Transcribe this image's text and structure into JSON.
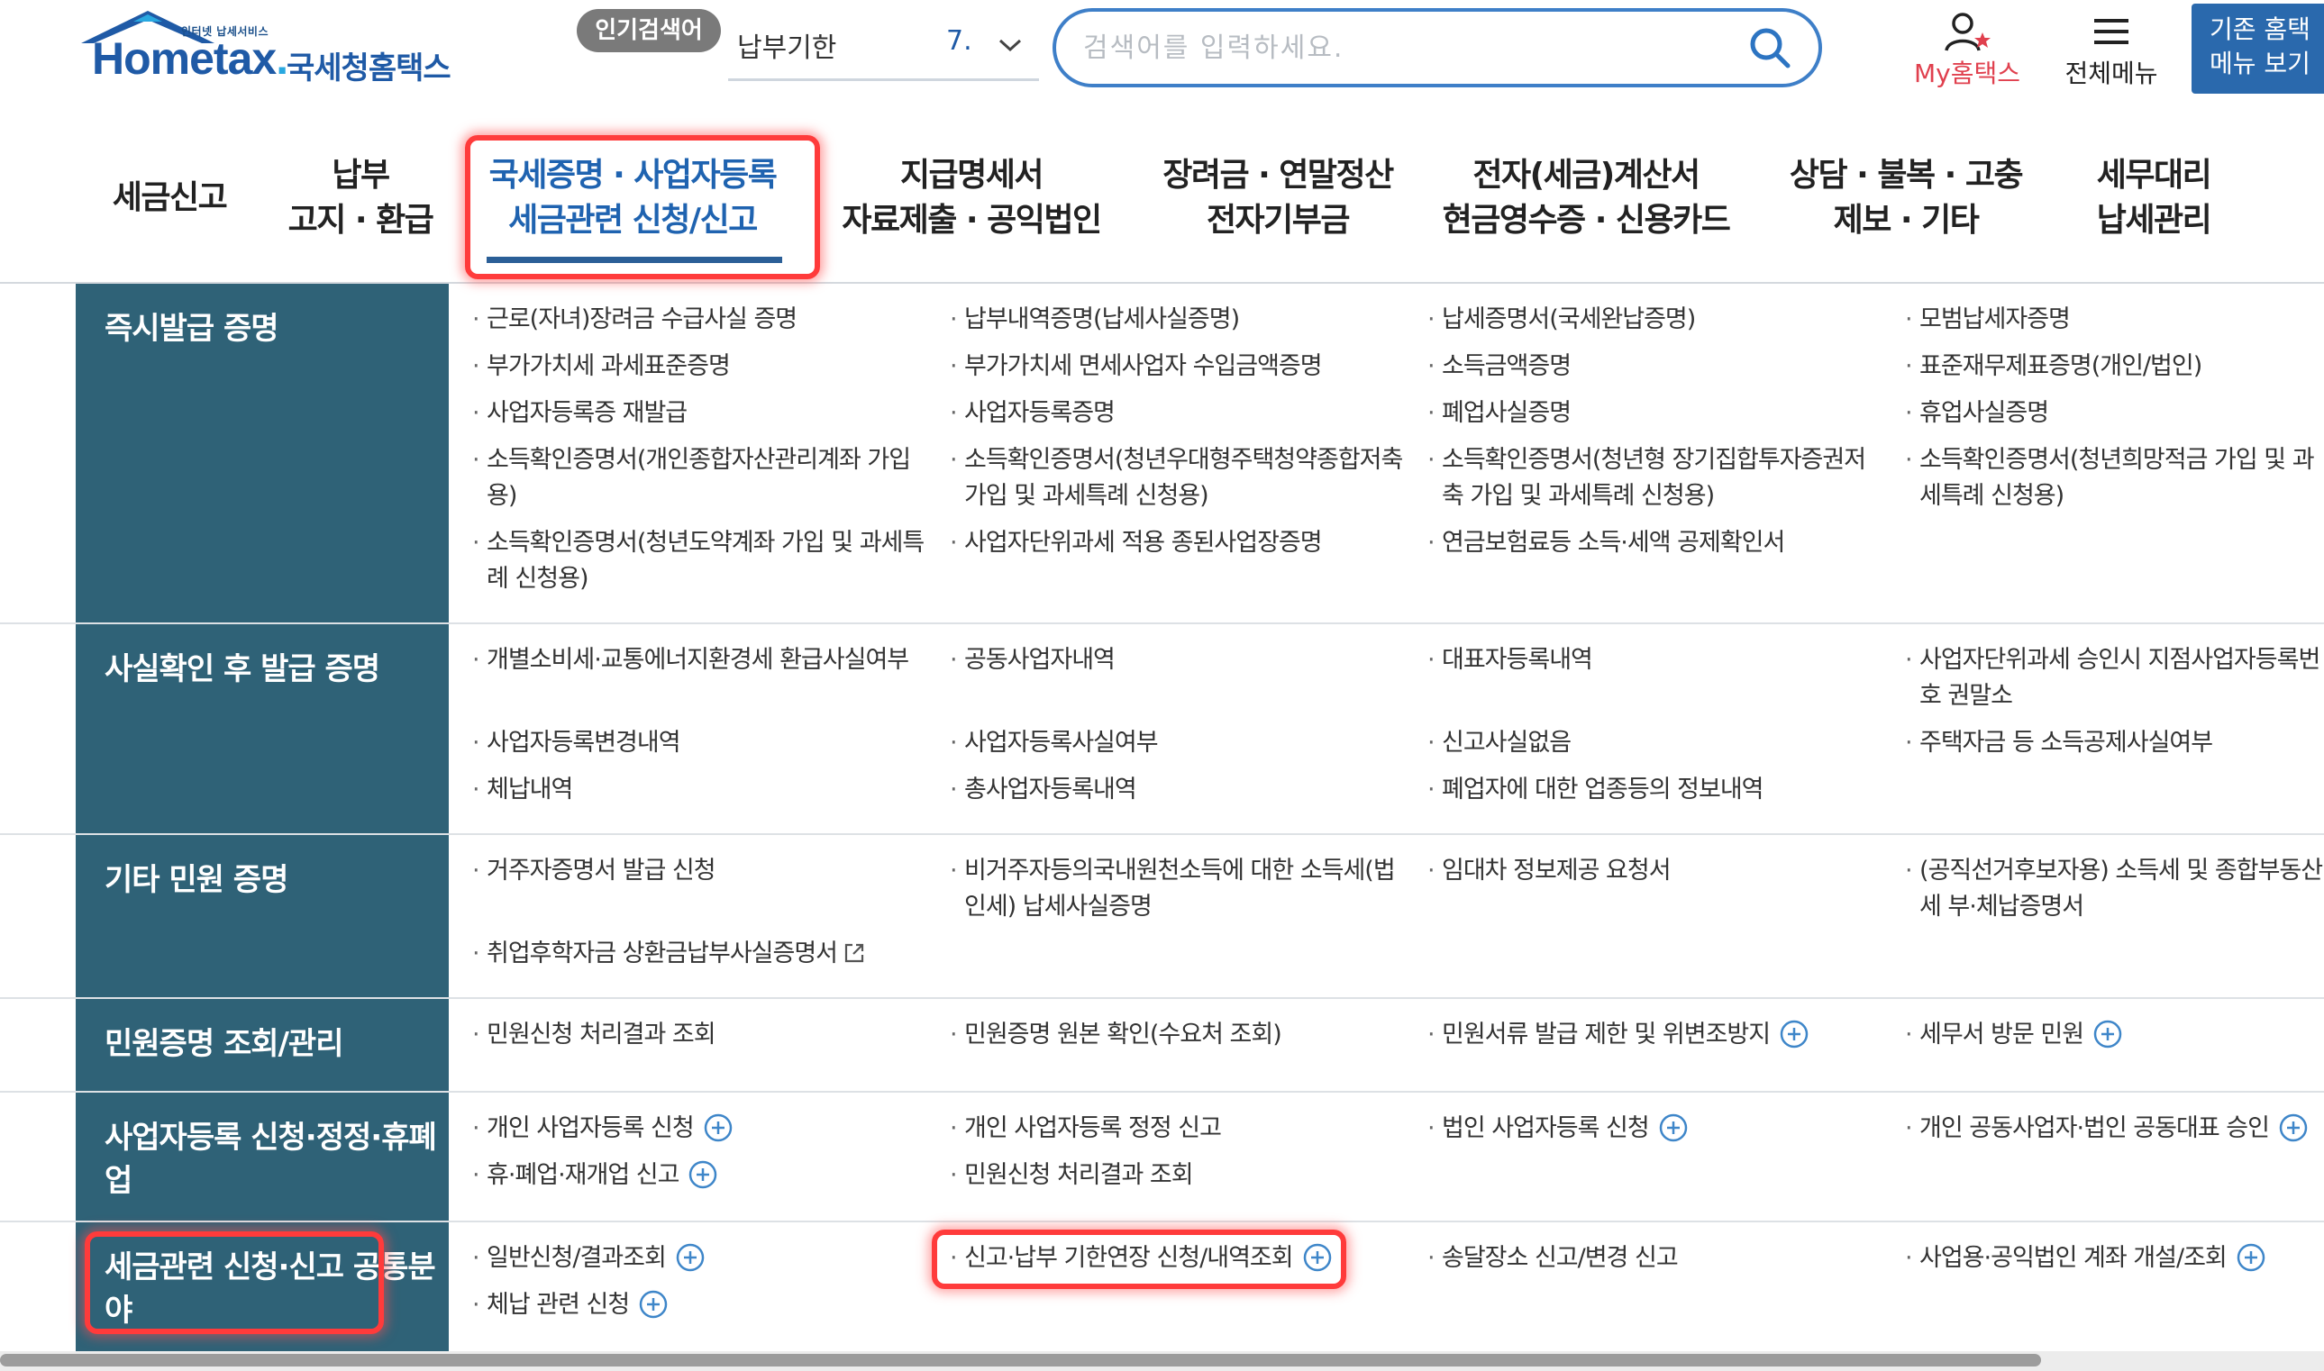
{
  "header": {
    "logo": {
      "small_text": "인터넷 납세서비스",
      "main_text": "Hometax",
      "korean_text": "국세청홈택스"
    },
    "popular_label": "인기검색어",
    "keyword": {
      "text": "납부기한",
      "rank": "7."
    },
    "search": {
      "placeholder": "검색어를 입력하세요.",
      "value": ""
    },
    "my_hometax": "My홈택스",
    "all_menu": "전체메뉴",
    "old_menu": "기존 홈택\n메뉴 보기"
  },
  "nav": [
    {
      "label": "세금신고"
    },
    {
      "label": "납부\n고지 · 환급"
    },
    {
      "label": "국세증명 · 사업자등록\n세금관련 신청/신고"
    },
    {
      "label": "지급명세서\n자료제출 · 공익법인"
    },
    {
      "label": "장려금 · 연말정산\n전자기부금"
    },
    {
      "label": "전자(세금)계산서\n현금영수증 · 신용카드"
    },
    {
      "label": "상담 · 불복 · 고충\n제보 · 기타"
    },
    {
      "label": "세무대리\n납세관리"
    }
  ],
  "sections": [
    {
      "title": "즉시발급 증명",
      "items": [
        "근로(자녀)장려금 수급사실 증명",
        "납부내역증명(납세사실증명)",
        "납세증명서(국세완납증명)",
        "모범납세자증명",
        "부가가치세 과세표준증명",
        "부가가치세 면세사업자 수입금액증명",
        "소득금액증명",
        "표준재무제표증명(개인/법인)",
        "사업자등록증 재발급",
        "사업자등록증명",
        "폐업사실증명",
        "휴업사실증명",
        "소득확인증명서(개인종합자산관리계좌 가입용)",
        "소득확인증명서(청년우대형주택청약종합저축 가입 및 과세특례 신청용)",
        "소득확인증명서(청년형 장기집합투자증권저축 가입 및 과세특례 신청용)",
        "소득확인증명서(청년희망적금 가입 및 과세특례 신청용)",
        "소득확인증명서(청년도약계좌 가입 및 과세특례 신청용)",
        "사업자단위과세 적용 종된사업장증명",
        "연금보험료등 소득·세액 공제확인서"
      ]
    },
    {
      "title": "사실확인 후 발급 증명",
      "items": [
        "개별소비세·교통에너지환경세 환급사실여부",
        "공동사업자내역",
        "대표자등록내역",
        "사업자단위과세 승인시 지점사업자등록번호 권말소",
        "사업자등록변경내역",
        "사업자등록사실여부",
        "신고사실없음",
        "주택자금 등 소득공제사실여부",
        "체납내역",
        "총사업자등록내역",
        "폐업자에 대한 업종등의 정보내역"
      ]
    },
    {
      "title": "기타 민원 증명",
      "items": [
        "거주자증명서 발급 신청",
        "비거주자등의국내원천소득에 대한 소득세(법인세) 납세사실증명",
        "임대차 정보제공 요청서",
        "(공직선거후보자용) 소득세 및 종합부동산세 부·체납증명서",
        "취업후학자금 상환금납부사실증명서"
      ]
    },
    {
      "title": "민원증명 조회/관리",
      "items": [
        "민원신청 처리결과 조회",
        "민원증명 원본 확인(수요처 조회)",
        "민원서류 발급 제한 및 위변조방지",
        "세무서 방문 민원"
      ]
    },
    {
      "title": "사업자등록 신청·정정·휴폐업",
      "items": [
        "개인 사업자등록 신청",
        "개인 사업자등록 정정 신고",
        "법인 사업자등록 신청",
        "개인 공동사업자·법인 공동대표 승인",
        "휴·폐업·재개업 신고",
        "민원신청 처리결과 조회"
      ]
    },
    {
      "title": "세금관련 신청·신고 공통분야",
      "items": [
        "일반신청/결과조회",
        "신고·납부 기한연장 신청/내역조회",
        "송달장소 신고/변경 신고",
        "사업용·공익법인 계좌 개설/조회",
        "체납 관련 신청"
      ]
    }
  ],
  "colors": {
    "brand_blue": "#1f5aa6",
    "section_head": "#2f6277",
    "highlight_red": "#ff3b3b",
    "my_hometax_red": "#e0404e"
  }
}
